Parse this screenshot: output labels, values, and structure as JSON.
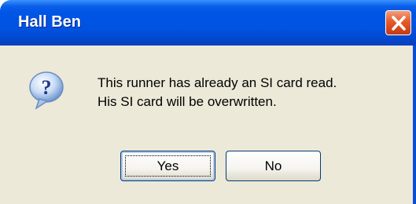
{
  "window": {
    "title": "Hall Ben",
    "close_icon": "close-icon"
  },
  "dialog": {
    "icon": "question-icon",
    "message_line1": "This runner has already an SI card read.",
    "message_line2": "His SI card will be overwritten."
  },
  "buttons": {
    "yes_label": "Yes",
    "no_label": "No"
  },
  "colors": {
    "titlebar": "#0055e5",
    "client_background": "#ece9d8",
    "close_button": "#e55a2a"
  }
}
